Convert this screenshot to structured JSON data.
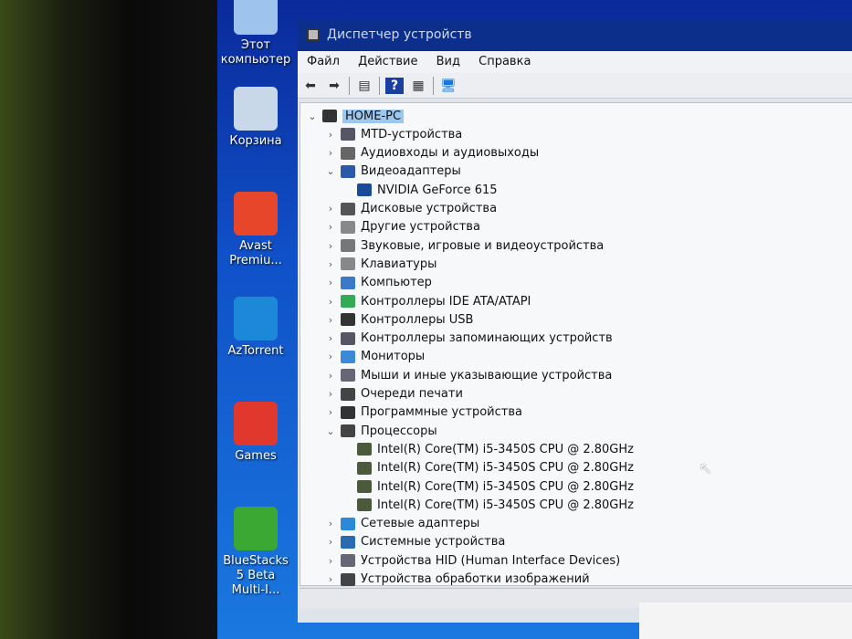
{
  "desktop": {
    "icons": [
      {
        "label": "Этот компьютер",
        "color": "#9ec4ee"
      },
      {
        "label": "Корзина",
        "color": "#c8d8e8"
      },
      {
        "label": "Avast Premiu...",
        "color": "#e8462a"
      },
      {
        "label": "AzTorrent",
        "color": "#1e88d8"
      },
      {
        "label": "Games",
        "color": "#e0382c"
      },
      {
        "label": "BlueStacks 5 Beta Multi-I...",
        "color": "#3aa832"
      }
    ]
  },
  "window": {
    "title": "Диспетчер устройств",
    "menu": [
      "Файл",
      "Действие",
      "Вид",
      "Справка"
    ],
    "toolbar": [
      "back-icon",
      "forward-icon",
      "properties-icon",
      "help-icon",
      "update-driver-icon",
      "scan-hardware-icon"
    ],
    "tree": {
      "root": "HOME-PC",
      "items": [
        {
          "label": "MTD-устройства",
          "expanded": false
        },
        {
          "label": "Аудиовходы и аудиовыходы",
          "expanded": false
        },
        {
          "label": "Видеоадаптеры",
          "expanded": true,
          "children": [
            "NVIDIA GeForce 615"
          ]
        },
        {
          "label": "Дисковые устройства",
          "expanded": false
        },
        {
          "label": "Другие устройства",
          "expanded": false
        },
        {
          "label": "Звуковые, игровые и видеоустройства",
          "expanded": false
        },
        {
          "label": "Клавиатуры",
          "expanded": false
        },
        {
          "label": "Компьютер",
          "expanded": false
        },
        {
          "label": "Контроллеры IDE ATA/ATAPI",
          "expanded": false
        },
        {
          "label": "Контроллеры USB",
          "expanded": false
        },
        {
          "label": "Контроллеры запоминающих устройств",
          "expanded": false
        },
        {
          "label": "Мониторы",
          "expanded": false
        },
        {
          "label": "Мыши и иные указывающие устройства",
          "expanded": false
        },
        {
          "label": "Очереди печати",
          "expanded": false
        },
        {
          "label": "Программные устройства",
          "expanded": false
        },
        {
          "label": "Процессоры",
          "expanded": true,
          "children": [
            "Intel(R) Core(TM) i5-3450S CPU @ 2.80GHz",
            "Intel(R) Core(TM) i5-3450S CPU @ 2.80GHz",
            "Intel(R) Core(TM) i5-3450S CPU @ 2.80GHz",
            "Intel(R) Core(TM) i5-3450S CPU @ 2.80GHz"
          ]
        },
        {
          "label": "Сетевые адаптеры",
          "expanded": false
        },
        {
          "label": "Системные устройства",
          "expanded": false
        },
        {
          "label": "Устройства HID (Human Interface Devices)",
          "expanded": false
        },
        {
          "label": "Устройства обработки изображений",
          "expanded": false
        }
      ]
    }
  }
}
